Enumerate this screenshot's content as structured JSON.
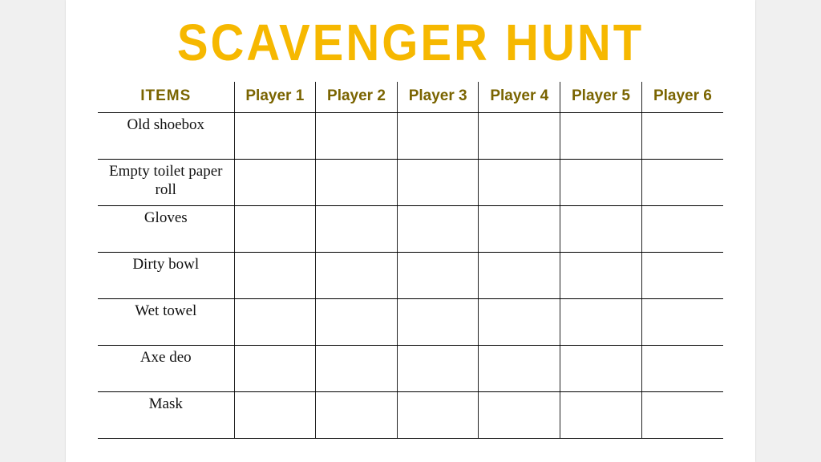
{
  "title": "SCAVENGER HUNT",
  "headers": {
    "items": "ITEMS",
    "players": [
      "Player 1",
      "Player 2",
      "Player 3",
      "Player 4",
      "Player 5",
      "Player 6"
    ]
  },
  "rows": [
    {
      "item": "Old shoebox"
    },
    {
      "item": "Empty toilet paper roll"
    },
    {
      "item": "Gloves"
    },
    {
      "item": "Dirty bowl"
    },
    {
      "item": "Wet towel"
    },
    {
      "item": "Axe deo"
    },
    {
      "item": "Mask"
    }
  ]
}
